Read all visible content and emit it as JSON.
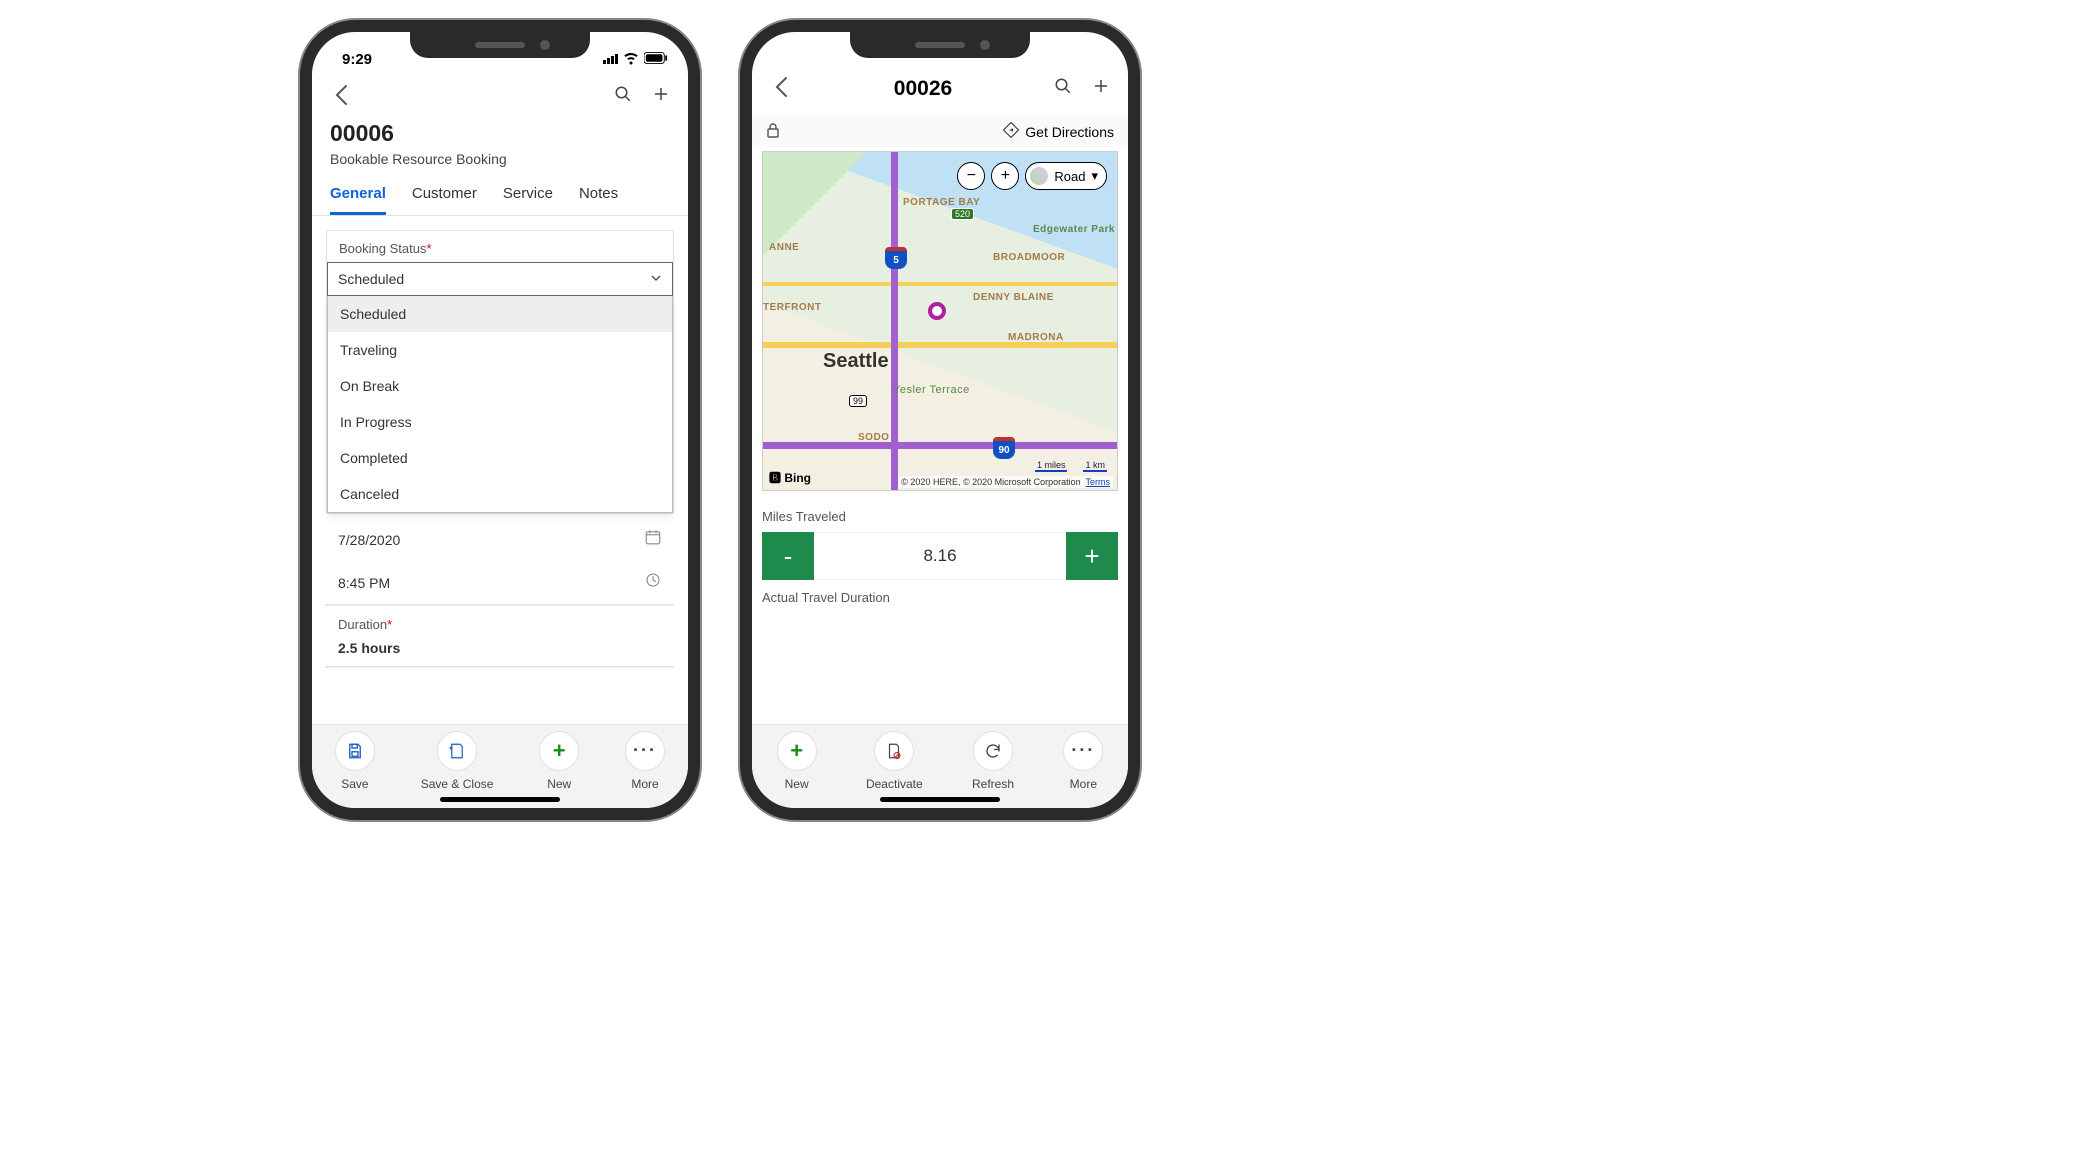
{
  "left": {
    "status_time": "9:29",
    "title": "00006",
    "subtitle": "Bookable Resource Booking",
    "tabs": [
      "General",
      "Customer",
      "Service",
      "Notes"
    ],
    "active_tab_index": 0,
    "booking_status": {
      "label": "Booking Status",
      "required": true,
      "selected": "Scheduled",
      "options": [
        "Scheduled",
        "Traveling",
        "On Break",
        "In Progress",
        "Completed",
        "Canceled"
      ]
    },
    "date": "7/28/2020",
    "time": "8:45 PM",
    "duration": {
      "label": "Duration",
      "required": true,
      "value": "2.5 hours"
    },
    "bottom": {
      "save": "Save",
      "save_close": "Save & Close",
      "new": "New",
      "more": "More"
    }
  },
  "right": {
    "title": "00026",
    "get_directions": "Get Directions",
    "map": {
      "zoom_out": "−",
      "zoom_in": "+",
      "style": "Road",
      "city": "Seattle",
      "labels": [
        "PORTAGE BAY",
        "BROADMOOR",
        "DENNY BLAINE",
        "MADRONA",
        "ANNE",
        "TERFRONT",
        "Edgewater Park",
        "Yesler Terrace",
        "SODO"
      ],
      "highways": {
        "i5": "5",
        "i90": "90",
        "sr520": "520",
        "sr99": "99"
      },
      "bing": "Bing",
      "attribution": "© 2020 HERE, © 2020 Microsoft Corporation",
      "terms": "Terms",
      "scale": [
        "1 miles",
        "1 km"
      ]
    },
    "miles": {
      "label": "Miles Traveled",
      "value": "8.16"
    },
    "actual_travel_duration_label": "Actual Travel Duration",
    "bottom": {
      "new": "New",
      "deactivate": "Deactivate",
      "refresh": "Refresh",
      "more": "More"
    }
  }
}
